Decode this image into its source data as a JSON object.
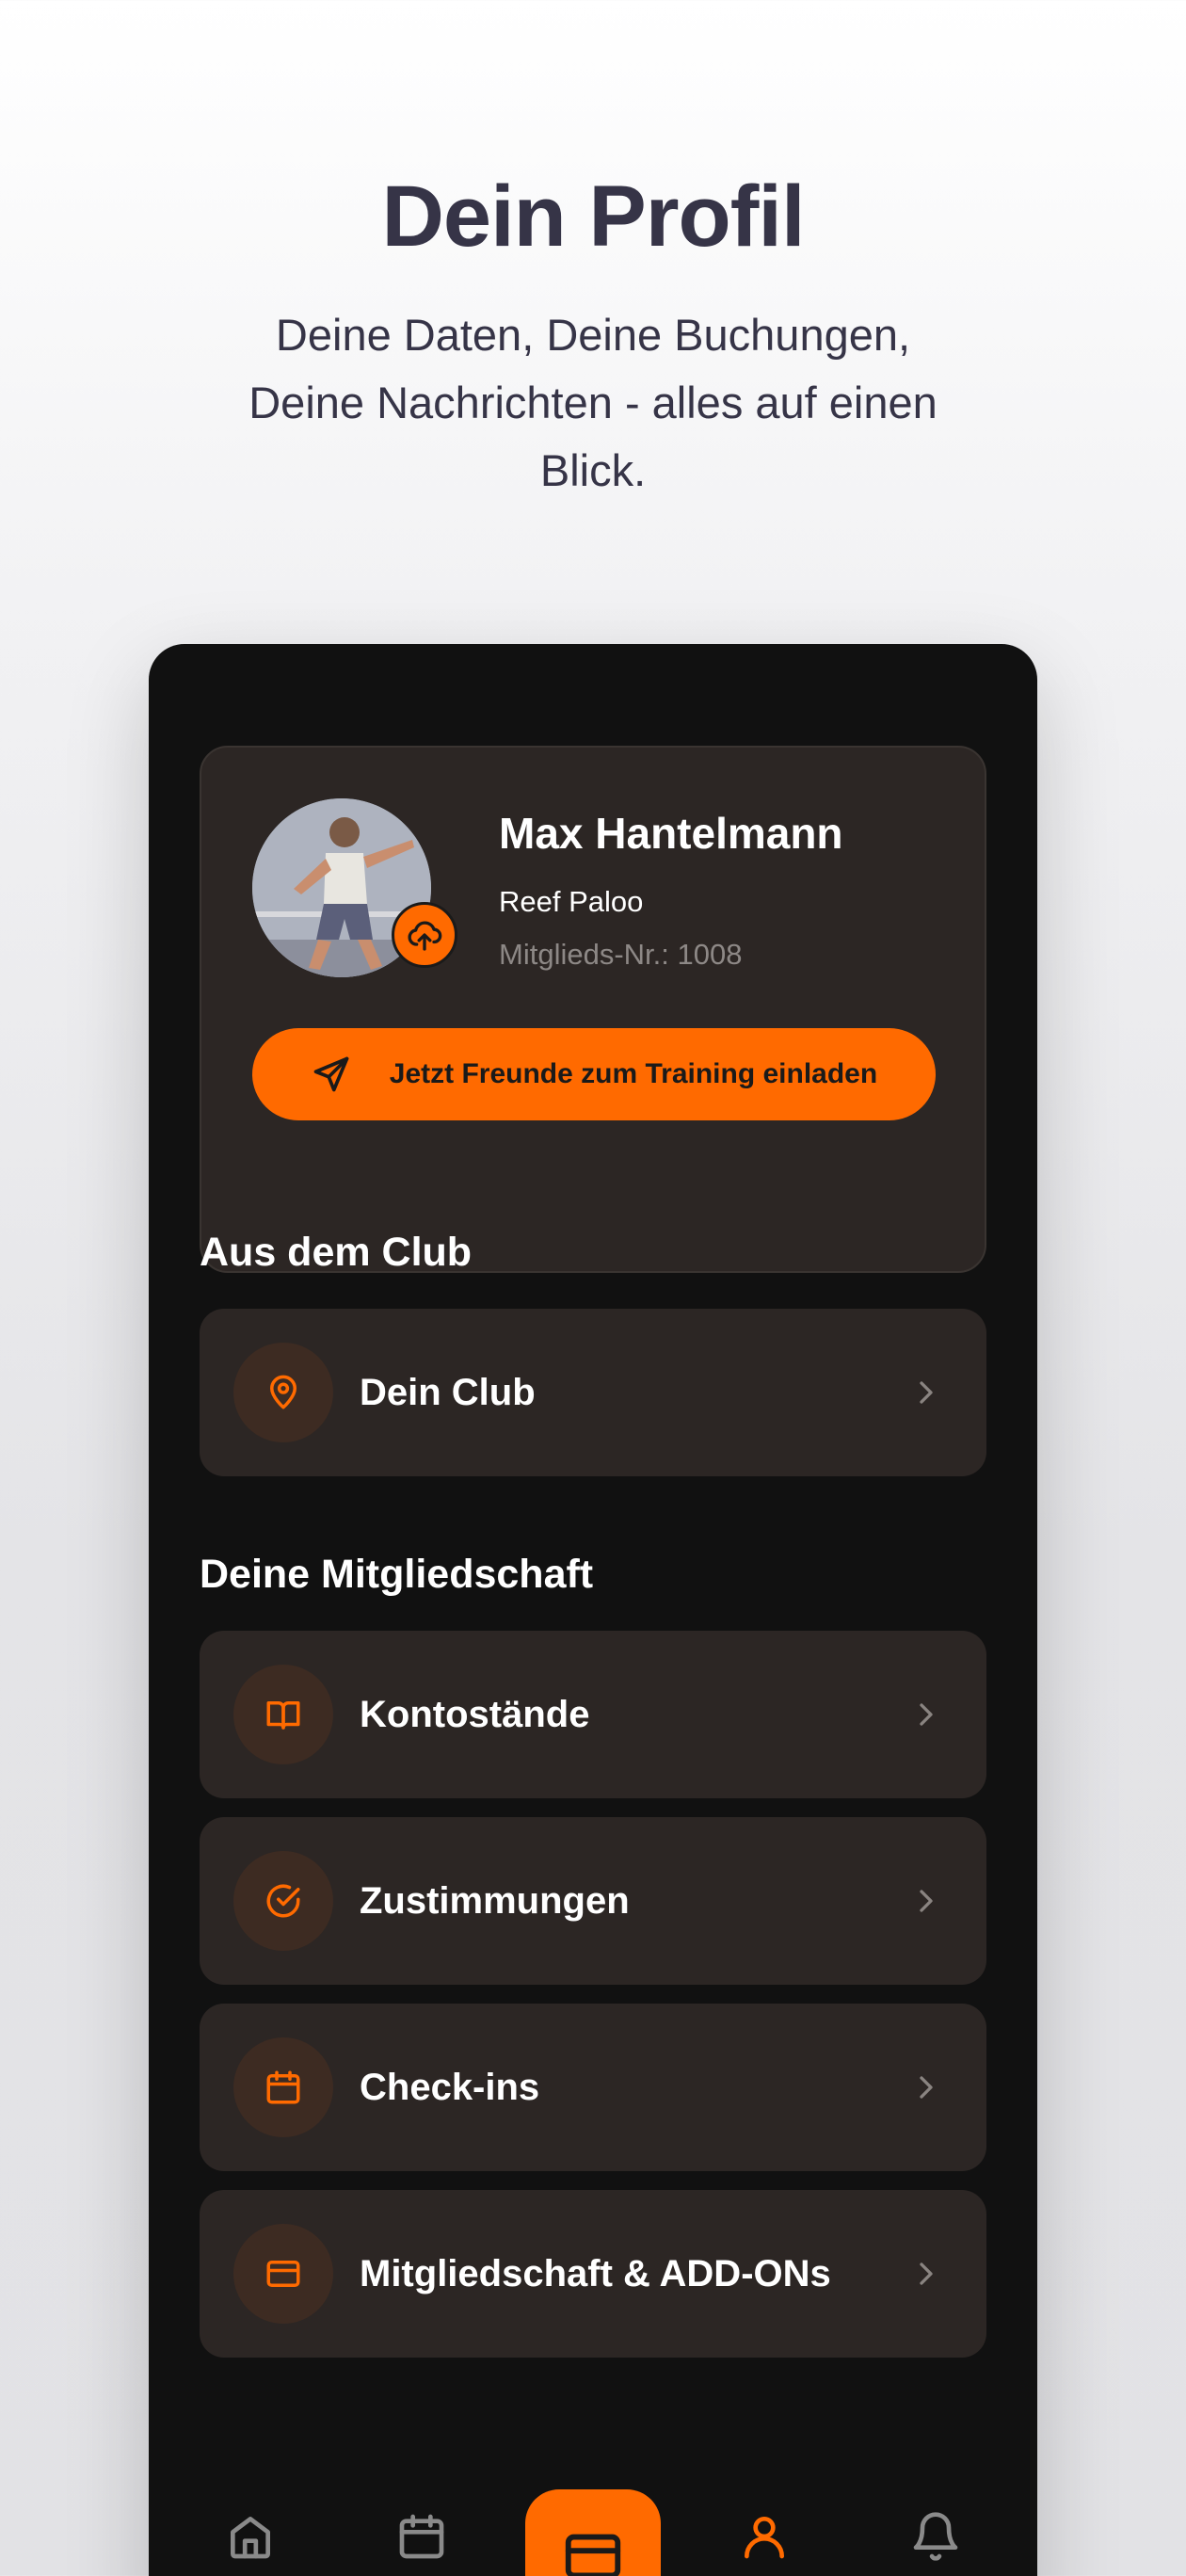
{
  "hero": {
    "title": "Dein Profil",
    "subtitle": "Deine Daten, Deine Buchungen, Deine Nachrichten - alles auf einen Blick."
  },
  "profile": {
    "name": "Max Hantelmann",
    "club": "Reef Paloo",
    "member_number": "Mitglieds-Nr.: 1008",
    "invite_label": "Jetzt Freunde zum Training einladen"
  },
  "sections": {
    "club_title": "Aus dem Club",
    "membership_title": "Deine Mitgliedschaft"
  },
  "club_items": [
    {
      "label": "Dein Club",
      "icon": "map-pin-icon"
    }
  ],
  "membership_items": [
    {
      "label": "Kontostände",
      "icon": "book-icon"
    },
    {
      "label": "Zustimmungen",
      "icon": "check-circle-icon"
    },
    {
      "label": "Check-ins",
      "icon": "calendar-icon"
    },
    {
      "label": "Mitgliedschaft & ADD-ONs",
      "icon": "credit-card-icon"
    }
  ],
  "nav": [
    {
      "icon": "home-icon",
      "active": false
    },
    {
      "icon": "calendar-icon",
      "active": false
    },
    {
      "icon": "credit-card-icon",
      "active": false,
      "center": true
    },
    {
      "icon": "user-icon",
      "active": true
    },
    {
      "icon": "bell-icon",
      "active": false
    }
  ],
  "colors": {
    "accent": "#ff6a00",
    "card": "#2c2624",
    "background": "#111111",
    "hero_text": "#363447"
  }
}
